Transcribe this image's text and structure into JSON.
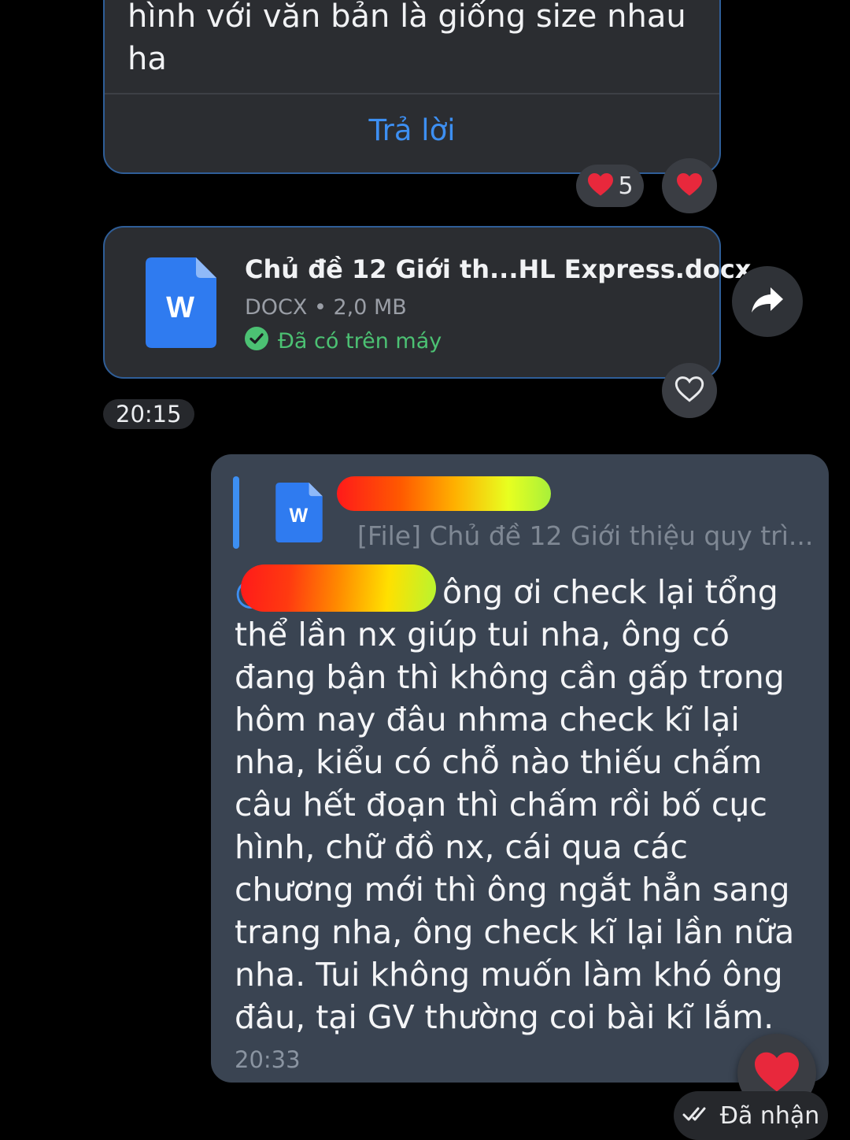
{
  "top_message": {
    "text_line1": "hình với văn bản là giống size nhau",
    "text_line2": "ha",
    "reply_label": "Trả lời",
    "reaction_count": "5"
  },
  "file_message": {
    "file_name": "Chủ đề 12 Giới th...HL Express.docx",
    "file_meta": "DOCX • 2,0 MB",
    "file_status": "Đã có trên máy",
    "icon_letter": "W",
    "time": "20:15"
  },
  "sent_message": {
    "quote_text": "[File] Chủ đề 12 Giới thiệu quy trì...",
    "quote_icon_letter": "W",
    "mention_prefix": "@",
    "text_first": "ông ơi check lại tổng",
    "text_rest": "thể lần nx giúp tui nha, ông có đang bận thì không cần gấp trong hôm nay đâu nhma check kĩ lại nha, kiểu có chỗ nào thiếu chấm câu hết đoạn thì chấm rồi bố cục hình, chữ đồ nx, cái qua các chương mới thì ông ngắt hẳn sang trang nha, ông check kĩ lại lần nữa nha. Tui không muốn làm khó ông đâu, tại GV thường coi bài kĩ lắm.",
    "time": "20:33",
    "status": "Đã nhận"
  },
  "colors": {
    "accent": "#3d8ff2",
    "bubble_received": "#2b2d31",
    "bubble_sent": "#3a4452",
    "heart": "#e8283c",
    "success": "#4cc173"
  }
}
